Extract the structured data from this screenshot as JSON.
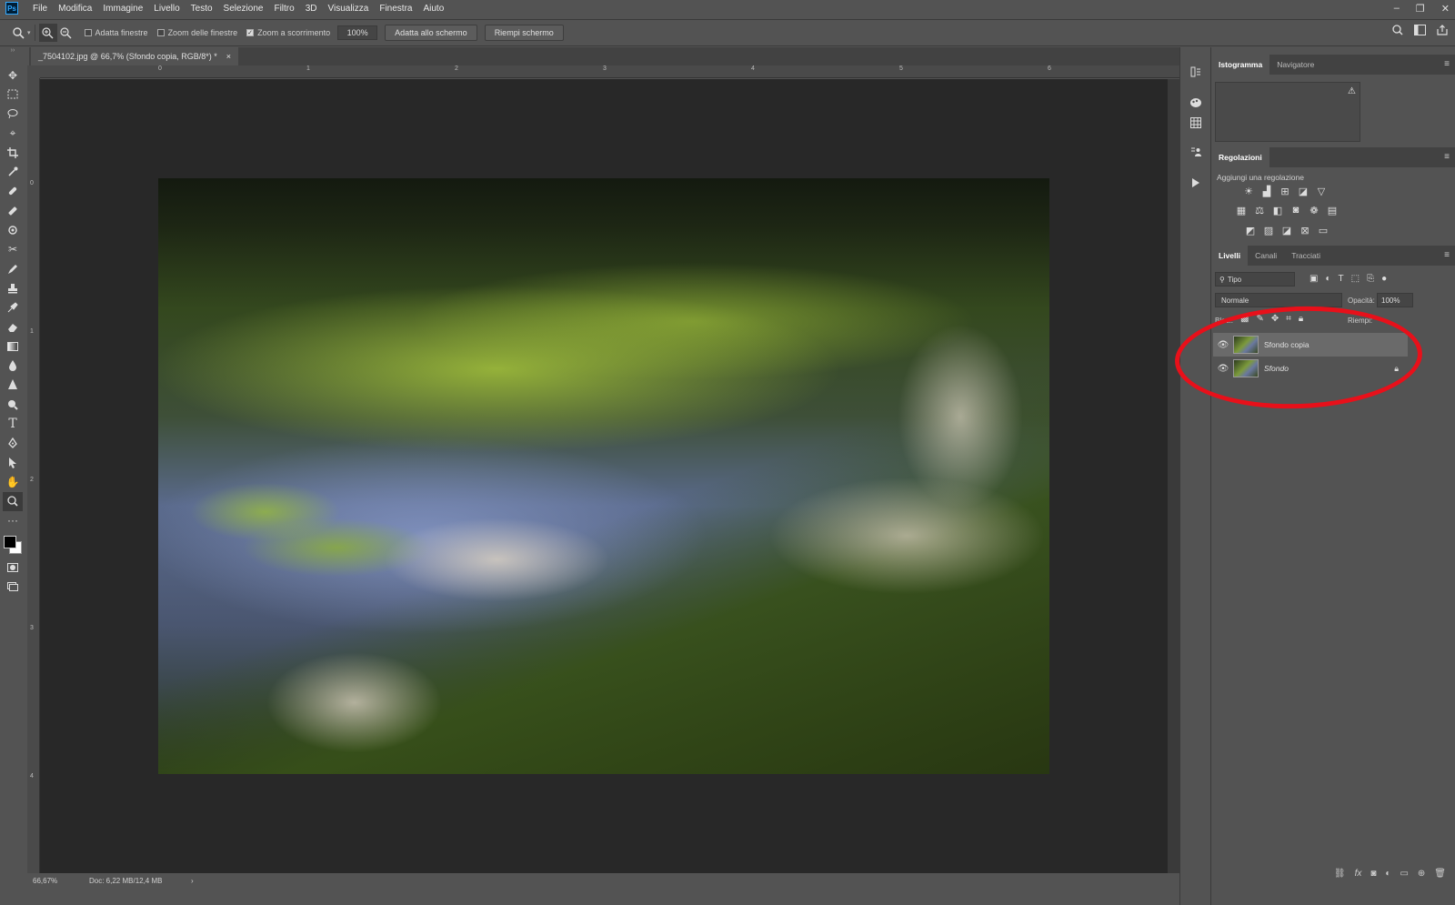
{
  "app": {
    "logo": "Ps"
  },
  "menu": [
    "File",
    "Modifica",
    "Immagine",
    "Livello",
    "Testo",
    "Selezione",
    "Filtro",
    "3D",
    "Visualizza",
    "Finestra",
    "Aiuto"
  ],
  "window_controls": {
    "minimize": "–",
    "restore": "❐",
    "close": "✕"
  },
  "options": {
    "zoom_icon": "zoom-icon",
    "chk1": "Adatta finestre",
    "chk2": "Zoom delle finestre",
    "chk3": "Zoom a scorrimento",
    "chk3_checked": "✓",
    "zoom_value": "100%",
    "btn_fit": "Adatta allo schermo",
    "btn_fill": "Riempi schermo"
  },
  "document": {
    "tab_title": "_7504102.jpg @ 66,7% (Sfondo copia, RGB/8*) *",
    "tab_close": "×",
    "ruler_top": [
      "0",
      "1",
      "2",
      "3",
      "4",
      "5",
      "6"
    ],
    "ruler_left": [
      "0",
      "1",
      "2",
      "3",
      "4"
    ]
  },
  "status": {
    "zoom": "66,67%",
    "doc": "Doc: 6,22 MB/12,4 MB",
    "arrow": "›"
  },
  "panels": {
    "top_tabs": [
      "Istogramma",
      "Navigatore"
    ],
    "histogram_warning": "⚠",
    "adjust_tab": "Regolazioni",
    "adjust_label": "Aggiungi una regolazione",
    "layer_tabs": [
      "Livelli",
      "Canali",
      "Tracciati"
    ],
    "filter_label": "Tipo",
    "blend_mode": "Normale",
    "opacity_label": "Opacità:",
    "opacity_value": "100%",
    "lock_label": "Bloc.:",
    "fill_label": "Riempi:",
    "layers": [
      {
        "name": "Sfondo copia",
        "visible": true,
        "selected": true
      },
      {
        "name": "Sfondo",
        "visible": true,
        "selected": false,
        "locked": true
      }
    ]
  },
  "accent_colors": {
    "annotation_red": "#e8101a"
  }
}
